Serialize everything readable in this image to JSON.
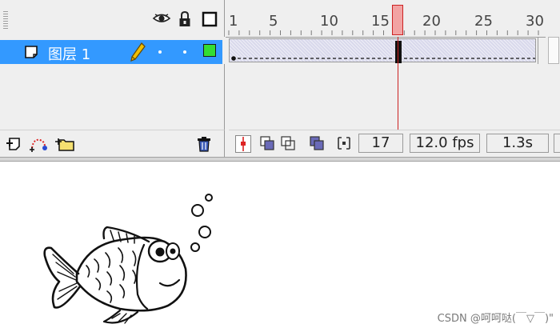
{
  "timeline": {
    "ruler_labels": [
      "1",
      "5",
      "10",
      "15",
      "20",
      "25",
      "30"
    ],
    "header_icons": [
      "eye-icon",
      "lock-icon",
      "outline-square-icon"
    ],
    "layer": {
      "name": "图层 1",
      "selected": true,
      "outline_color": "#33dd33",
      "icons": [
        "layer-page-icon",
        "pencil-icon"
      ]
    },
    "layer_tools": [
      "insert-layer-icon",
      "add-motion-guide-icon",
      "insert-folder-icon",
      "trash-icon"
    ],
    "current_frame": "17",
    "frame_rate": "12.0 fps",
    "elapsed_time": "1.3s",
    "selection_color": "#3399ff",
    "playhead_color": "#cc2222"
  },
  "stage": {
    "watermark": "CSDN @呵呵哒(￣▽￣)\"",
    "drawing": "goldfish-with-bubbles"
  }
}
